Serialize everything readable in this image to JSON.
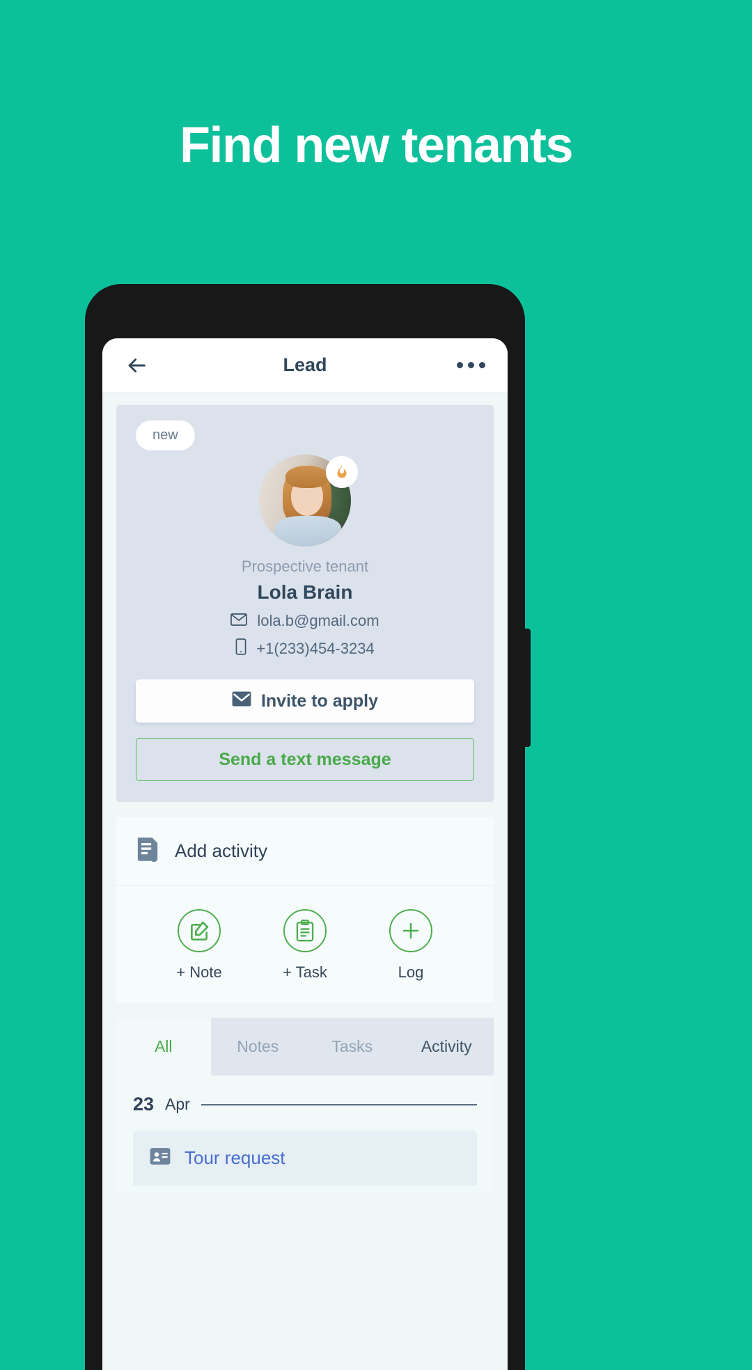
{
  "marketing": {
    "headline": "Find new tenants",
    "background_color": "#0cc09a"
  },
  "app": {
    "header": {
      "title": "Lead",
      "back_icon": "arrow-left-icon",
      "menu_icon": "more-horizontal-icon"
    },
    "profile_card": {
      "status_badge": "new",
      "flame_badge_icon": "flame-icon",
      "role": "Prospective tenant",
      "name": "Lola Brain",
      "email": "lola.b@gmail.com",
      "email_icon": "envelope-icon",
      "phone": "+1(233)454-3234",
      "phone_icon": "mobile-icon",
      "primary_button": {
        "label": "Invite to apply",
        "icon": "envelope-filled-icon"
      },
      "secondary_button": {
        "label": "Send a text message",
        "color": "#4aa94a"
      },
      "card_color": "#dbe2ec"
    },
    "add_activity": {
      "label": "Add activity",
      "icon": "document-lines-icon",
      "actions": [
        {
          "label": "+ Note",
          "icon": "note-edit-icon"
        },
        {
          "label": "+ Task",
          "icon": "clipboard-icon"
        },
        {
          "label": "Log",
          "icon": "plus-circle-icon"
        }
      ]
    },
    "tabs": [
      {
        "label": "All",
        "active": true
      },
      {
        "label": "Notes",
        "active": false
      },
      {
        "label": "Tasks",
        "active": false
      },
      {
        "label": "Activity",
        "active": false
      }
    ],
    "timeline": {
      "date_day": "23",
      "date_month": "Apr",
      "items": [
        {
          "title": "Tour request",
          "icon": "card-id-icon"
        }
      ]
    }
  }
}
